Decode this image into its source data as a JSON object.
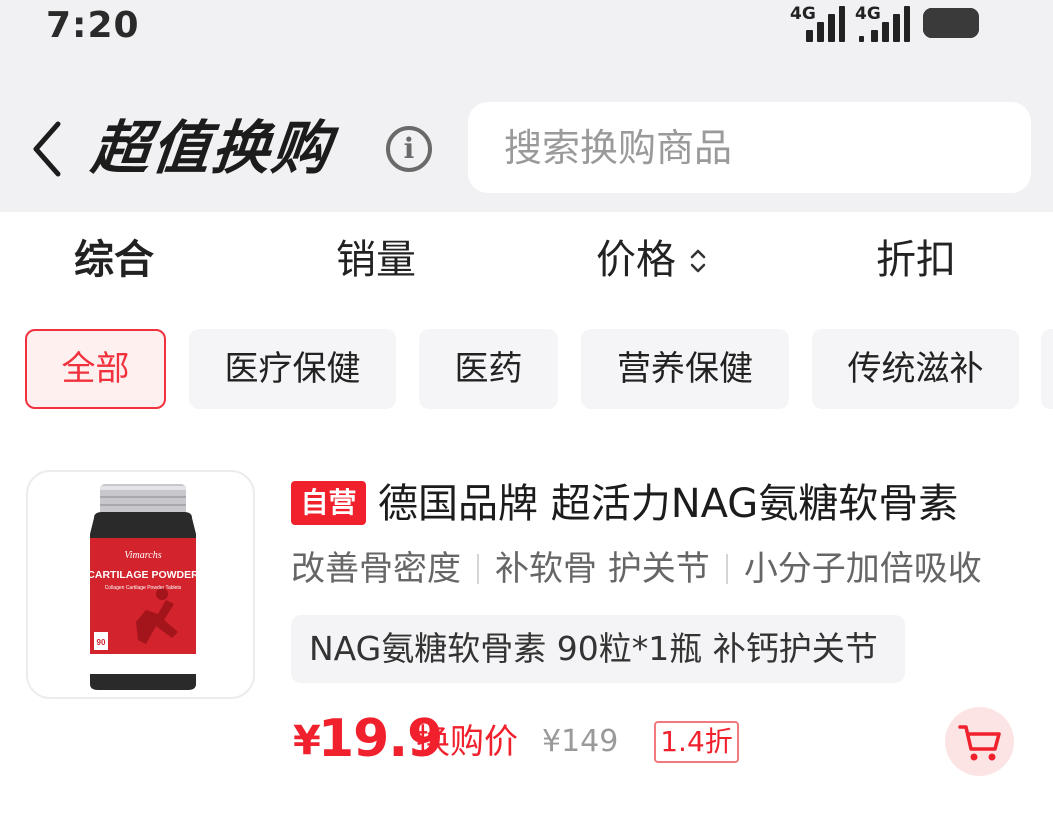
{
  "status_bar": {
    "time": "7:20",
    "signal_1_label": "4G",
    "signal_2_label": "4G",
    "battery": "35"
  },
  "header": {
    "title": "超值换购",
    "search_placeholder": "搜索换购商品"
  },
  "sort_tabs": [
    {
      "label": "综合",
      "active": true
    },
    {
      "label": "销量",
      "active": false
    },
    {
      "label": "价格",
      "active": false
    },
    {
      "label": "折扣",
      "active": false
    }
  ],
  "categories": [
    {
      "label": "全部",
      "active": true
    },
    {
      "label": "医疗保健",
      "active": false
    },
    {
      "label": "医药",
      "active": false
    },
    {
      "label": "营养保健",
      "active": false
    },
    {
      "label": "传统滋补",
      "active": false
    }
  ],
  "product": {
    "tag": "自营",
    "title": "德国品牌 超活力NAG氨糖软骨素",
    "features": [
      "改善骨密度",
      "补软骨 护关节",
      "小分子加倍吸收"
    ],
    "spec": "NAG氨糖软骨素 90粒*1瓶 补钙护关节",
    "price_symbol": "¥",
    "price": "19.9",
    "price_label": "换购价",
    "original_price": "¥149",
    "discount": "1.4折",
    "image_brand": "Vimarchs",
    "image_name": "CARTILAGE POWDER",
    "image_sub": "Collagen Cartilage Powder Tablets",
    "image_count": "90"
  },
  "colors": {
    "accent": "#f1202d",
    "header_bg": "#f1f1f3",
    "chip_bg": "#f5f5f7"
  }
}
